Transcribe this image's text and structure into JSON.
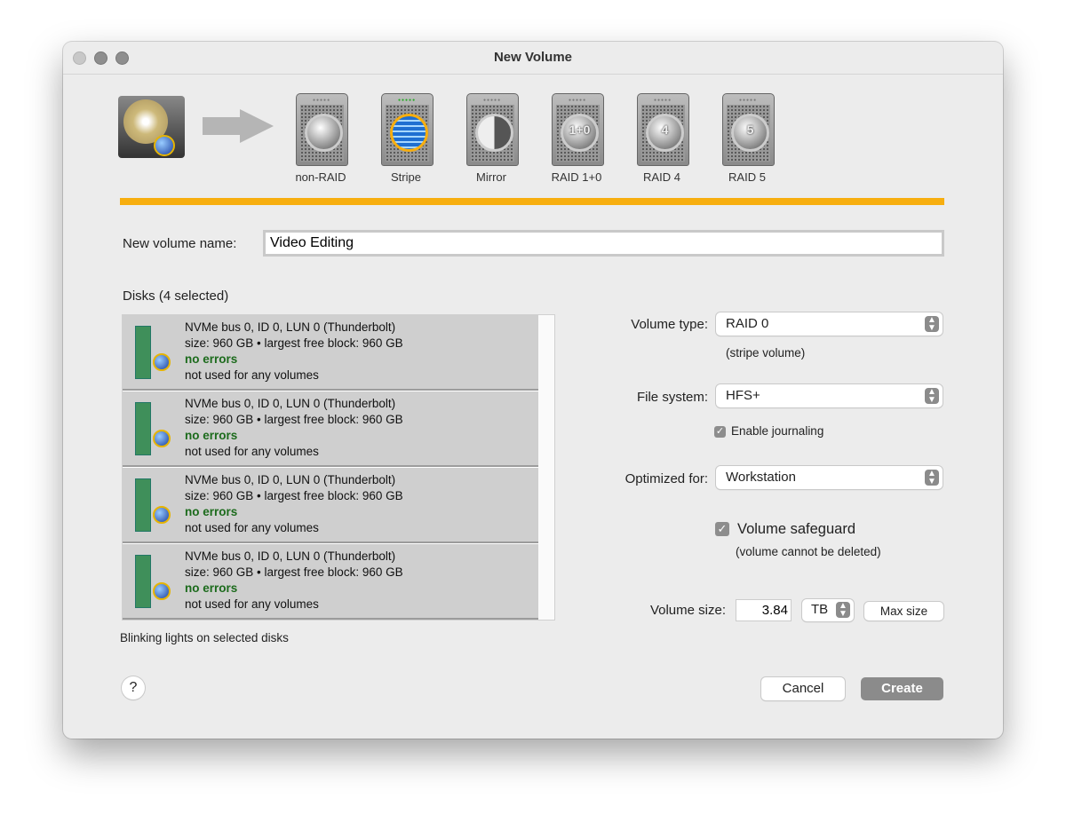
{
  "window": {
    "title": "New Volume"
  },
  "raid_types": [
    {
      "label": "non-RAID",
      "selected": false
    },
    {
      "label": "Stripe",
      "selected": true
    },
    {
      "label": "Mirror",
      "selected": false
    },
    {
      "label": "RAID 1+0",
      "selected": false
    },
    {
      "label": "RAID 4",
      "selected": false
    },
    {
      "label": "RAID 5",
      "selected": false
    }
  ],
  "accent": "#f7ae0f",
  "name_label": "New volume name:",
  "name_value": "Video Editing",
  "disks_label": "Disks (4 selected)",
  "disks": [
    {
      "name": "NVMe bus 0, ID 0, LUN 0 (Thunderbolt)",
      "size": "size: 960 GB • largest free block: 960 GB",
      "status": "no errors",
      "usage": "not used for any volumes"
    },
    {
      "name": "NVMe bus 0, ID 0, LUN 0 (Thunderbolt)",
      "size": "size: 960 GB • largest free block: 960 GB",
      "status": "no errors",
      "usage": "not used for any volumes"
    },
    {
      "name": "NVMe bus 0, ID 0, LUN 0 (Thunderbolt)",
      "size": "size: 960 GB • largest free block: 960 GB",
      "status": "no errors",
      "usage": "not used for any volumes"
    },
    {
      "name": "NVMe bus 0, ID 0, LUN 0 (Thunderbolt)",
      "size": "size: 960 GB • largest free block: 960 GB",
      "status": "no errors",
      "usage": "not used for any volumes"
    }
  ],
  "blink_note": "Blinking lights on selected disks",
  "volume_type": {
    "label": "Volume type:",
    "value": "RAID 0",
    "note": "(stripe volume)"
  },
  "file_system": {
    "label": "File system:",
    "value": "HFS+",
    "journaling_label": "Enable journaling",
    "journaling": true
  },
  "optimized": {
    "label": "Optimized for:",
    "value": "Workstation"
  },
  "safeguard": {
    "label": "Volume safeguard",
    "note": "(volume cannot be deleted)",
    "checked": true
  },
  "size": {
    "label": "Volume size:",
    "value": "3.84",
    "unit": "TB",
    "max_label": "Max size"
  },
  "help": "?",
  "cancel": "Cancel",
  "create": "Create"
}
